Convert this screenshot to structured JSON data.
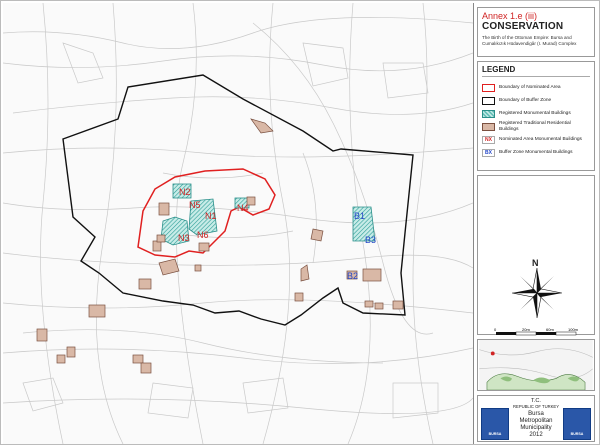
{
  "title": {
    "annex": "Annex 1.e (iii)",
    "heading": "CONSERVATION",
    "subtitle": "The Birth of the Ottoman Empire: Bursa and Cumalıkızık Hüdavendigâr (I. Murad) Complex"
  },
  "legend": {
    "heading": "LEGEND",
    "items": [
      {
        "swatch": "red-outline",
        "label": "Boundary of Nominated Area"
      },
      {
        "swatch": "black-outline",
        "label": "Boundary of Buffer Zone"
      },
      {
        "swatch": "hatched-teal",
        "label": "Registered Monumental Buildings"
      },
      {
        "swatch": "brown-fill",
        "label": "Registered Traditional Residential Buildings"
      },
      {
        "swatch": "red-code",
        "code": "NX",
        "label": "Nominated Area Monumental Buildings"
      },
      {
        "swatch": "blue-code",
        "code": "BX",
        "label": "Buffer Zone Monumental Buildings"
      }
    ]
  },
  "compass": {
    "north_label": "N"
  },
  "scale": {
    "labels": [
      "0",
      "20m",
      "60m",
      "100m"
    ]
  },
  "map_labels": {
    "nominated": [
      "N1",
      "N2",
      "N3",
      "N4",
      "N5",
      "N6"
    ],
    "buffer": [
      "B1",
      "B2",
      "B3"
    ]
  },
  "credits": {
    "country": "T.C.",
    "republic": "REPUBLIC OF TURKEY",
    "municipality_line1": "Bursa",
    "municipality_line2": "Metropolitan",
    "municipality_line3": "Municipality",
    "year": "2012",
    "logo_left": "BURSA",
    "logo_right": "BURSA"
  },
  "colors": {
    "nominated_boundary": "#e02020",
    "buffer_boundary": "#111111",
    "monumental_fill": "#6cc4bd",
    "residential_fill": "#d9b8a6",
    "nominated_code": "#d02424",
    "buffer_code": "#2446c8"
  }
}
